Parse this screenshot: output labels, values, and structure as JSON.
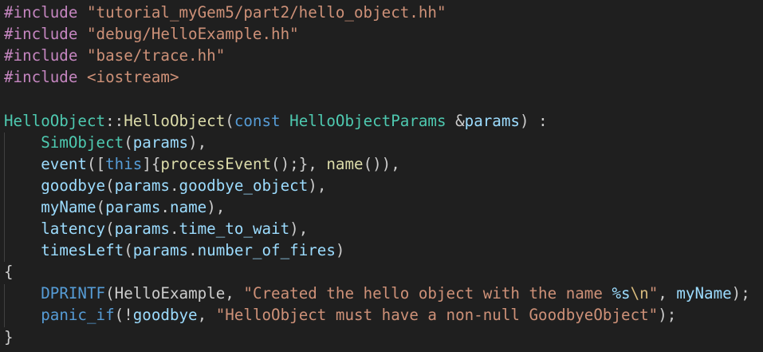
{
  "colors": {
    "background": "#1f1f1f",
    "preprocessor": "#c586c0",
    "string": "#ce9178",
    "include_system": "#ce9178",
    "type": "#4ec9b0",
    "function": "#dcdcaa",
    "keyword": "#569cd6",
    "variable": "#9cdcfe",
    "punctuation": "#cccccc",
    "format_spec": "#9cdcfe",
    "escape": "#d7ba7d",
    "brace": "#da70d6",
    "indent_guide": "#404040"
  },
  "code_lines": [
    [
      {
        "t": "#include",
        "c": "preprocessor"
      },
      {
        "t": " ",
        "c": "punctuation"
      },
      {
        "t": "\"tutorial_myGem5/part2/hello_object.hh\"",
        "c": "string"
      }
    ],
    [
      {
        "t": "#include",
        "c": "preprocessor"
      },
      {
        "t": " ",
        "c": "punctuation"
      },
      {
        "t": "\"debug/HelloExample.hh\"",
        "c": "string"
      }
    ],
    [
      {
        "t": "#include",
        "c": "preprocessor"
      },
      {
        "t": " ",
        "c": "punctuation"
      },
      {
        "t": "\"base/trace.hh\"",
        "c": "string"
      }
    ],
    [
      {
        "t": "#include",
        "c": "preprocessor"
      },
      {
        "t": " ",
        "c": "punctuation"
      },
      {
        "t": "<iostream>",
        "c": "include_system"
      }
    ],
    [],
    [
      {
        "t": "HelloObject",
        "c": "type"
      },
      {
        "t": "::",
        "c": "punctuation"
      },
      {
        "t": "HelloObject",
        "c": "function"
      },
      {
        "t": "(",
        "c": "punctuation"
      },
      {
        "t": "const",
        "c": "keyword"
      },
      {
        "t": " ",
        "c": "punctuation"
      },
      {
        "t": "HelloObjectParams",
        "c": "type"
      },
      {
        "t": " &",
        "c": "punctuation"
      },
      {
        "t": "params",
        "c": "variable"
      },
      {
        "t": ") :",
        "c": "punctuation"
      }
    ],
    [
      {
        "t": "    ",
        "c": "punctuation"
      },
      {
        "t": "SimObject",
        "c": "type"
      },
      {
        "t": "(",
        "c": "punctuation"
      },
      {
        "t": "params",
        "c": "variable"
      },
      {
        "t": "),",
        "c": "punctuation"
      }
    ],
    [
      {
        "t": "    ",
        "c": "punctuation"
      },
      {
        "t": "event",
        "c": "variable"
      },
      {
        "t": "([",
        "c": "punctuation"
      },
      {
        "t": "this",
        "c": "keyword"
      },
      {
        "t": "]{",
        "c": "punctuation"
      },
      {
        "t": "processEvent",
        "c": "function"
      },
      {
        "t": "();}, ",
        "c": "punctuation"
      },
      {
        "t": "name",
        "c": "function"
      },
      {
        "t": "()),",
        "c": "punctuation"
      }
    ],
    [
      {
        "t": "    ",
        "c": "punctuation"
      },
      {
        "t": "goodbye",
        "c": "variable"
      },
      {
        "t": "(",
        "c": "punctuation"
      },
      {
        "t": "params",
        "c": "variable"
      },
      {
        "t": ".",
        "c": "punctuation"
      },
      {
        "t": "goodbye_object",
        "c": "variable"
      },
      {
        "t": "),",
        "c": "punctuation"
      }
    ],
    [
      {
        "t": "    ",
        "c": "punctuation"
      },
      {
        "t": "myName",
        "c": "variable"
      },
      {
        "t": "(",
        "c": "punctuation"
      },
      {
        "t": "params",
        "c": "variable"
      },
      {
        "t": ".",
        "c": "punctuation"
      },
      {
        "t": "name",
        "c": "variable"
      },
      {
        "t": "),",
        "c": "punctuation"
      }
    ],
    [
      {
        "t": "    ",
        "c": "punctuation"
      },
      {
        "t": "latency",
        "c": "variable"
      },
      {
        "t": "(",
        "c": "punctuation"
      },
      {
        "t": "params",
        "c": "variable"
      },
      {
        "t": ".",
        "c": "punctuation"
      },
      {
        "t": "time_to_wait",
        "c": "variable"
      },
      {
        "t": "),",
        "c": "punctuation"
      }
    ],
    [
      {
        "t": "    ",
        "c": "punctuation"
      },
      {
        "t": "timesLeft",
        "c": "variable"
      },
      {
        "t": "(",
        "c": "punctuation"
      },
      {
        "t": "params",
        "c": "variable"
      },
      {
        "t": ".",
        "c": "punctuation"
      },
      {
        "t": "number_of_fires",
        "c": "variable"
      },
      {
        "t": ")",
        "c": "punctuation"
      }
    ],
    [
      {
        "t": "{",
        "c": "punctuation"
      }
    ],
    [
      {
        "t": "    ",
        "c": "punctuation"
      },
      {
        "t": "DPRINTF",
        "c": "keyword"
      },
      {
        "t": "(",
        "c": "punctuation"
      },
      {
        "t": "HelloExample",
        "c": "punctuation"
      },
      {
        "t": ", ",
        "c": "punctuation"
      },
      {
        "t": "\"Created the hello object with the name ",
        "c": "string"
      },
      {
        "t": "%s",
        "c": "format_spec"
      },
      {
        "t": "\\n",
        "c": "escape"
      },
      {
        "t": "\"",
        "c": "string"
      },
      {
        "t": ", ",
        "c": "punctuation"
      },
      {
        "t": "myName",
        "c": "variable"
      },
      {
        "t": ");",
        "c": "punctuation"
      }
    ],
    [
      {
        "t": "    ",
        "c": "punctuation"
      },
      {
        "t": "panic_if",
        "c": "keyword"
      },
      {
        "t": "(!",
        "c": "punctuation"
      },
      {
        "t": "goodbye",
        "c": "variable"
      },
      {
        "t": ", ",
        "c": "punctuation"
      },
      {
        "t": "\"HelloObject must have a non-null GoodbyeObject\"",
        "c": "string"
      },
      {
        "t": ");",
        "c": "punctuation"
      }
    ],
    [
      {
        "t": "}",
        "c": "punctuation"
      }
    ]
  ]
}
